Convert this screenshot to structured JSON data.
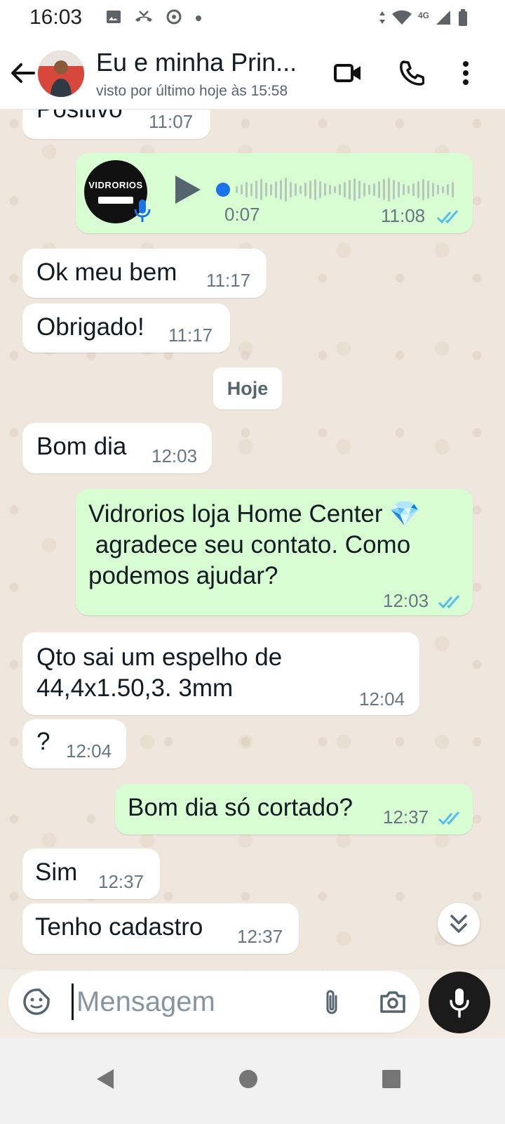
{
  "status_bar": {
    "time": "16:03",
    "network": "4G"
  },
  "header": {
    "contact_name": "Eu e minha Prin...",
    "last_seen": "visto por último hoje às 15:58"
  },
  "messages": [
    {
      "dir": "in",
      "text": "Positivo",
      "time": "11:07"
    },
    {
      "dir": "out",
      "type": "voice",
      "thumb_logo": "VIDRORIOS",
      "duration": "0:07",
      "time": "11:08",
      "read": true
    },
    {
      "dir": "in",
      "text": "Ok meu bem",
      "time": "11:17"
    },
    {
      "dir": "in",
      "text": "Obrigado!",
      "time": "11:17"
    },
    {
      "dir": "out",
      "lines": [
        "Vidrorios loja Home Center 💎",
        " agradece seu contato. Como",
        "podemos ajudar?"
      ],
      "time": "12:03",
      "read": true
    },
    {
      "dir": "in",
      "text": "Bom dia",
      "time": "12:03"
    },
    {
      "dir": "in",
      "lines": [
        "Qto sai um espelho de",
        "44,4x1.50,3. 3mm"
      ],
      "time": "12:04"
    },
    {
      "dir": "in",
      "text": "?",
      "time": "12:04"
    },
    {
      "dir": "out",
      "text": "Bom dia só cortado?",
      "time": "12:37",
      "read": true
    },
    {
      "dir": "in",
      "text": "Sim",
      "time": "12:37"
    },
    {
      "dir": "in",
      "text": "Tenho cadastro",
      "time": "12:37"
    }
  ],
  "date_separator": "Hoje",
  "composer": {
    "placeholder": "Mensagem"
  },
  "colors": {
    "outgoing_bubble": "#d9fdd3",
    "incoming_bubble": "#ffffff",
    "chat_background": "#efe7dd",
    "read_ticks": "#53bdeb",
    "voice_dot": "#1a73e8"
  }
}
